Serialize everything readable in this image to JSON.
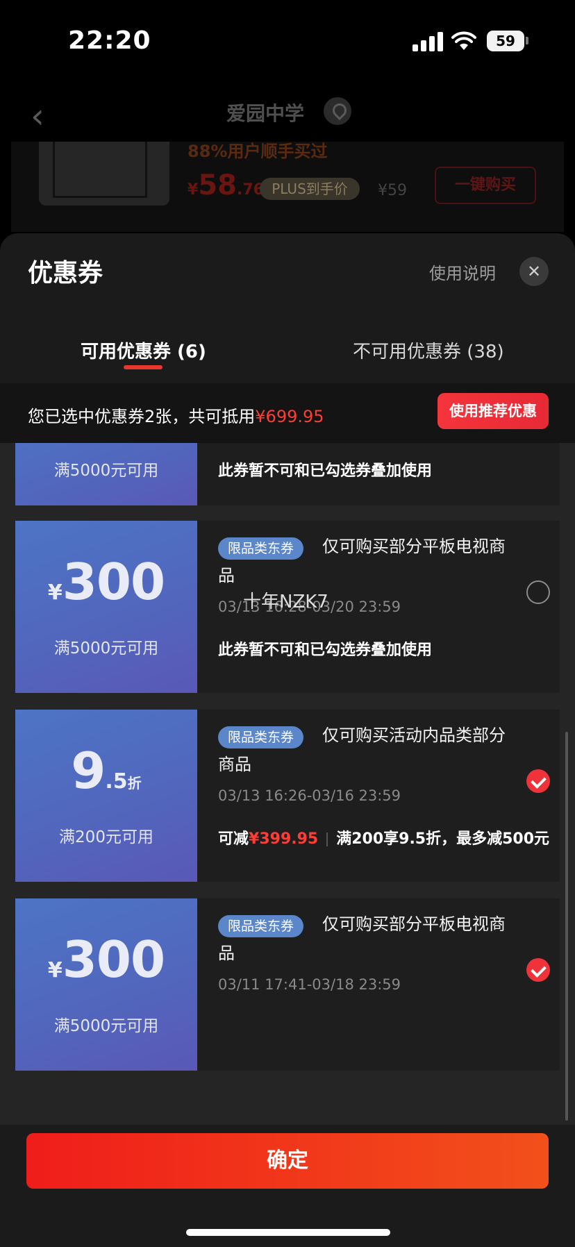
{
  "status_bar": {
    "time": "22:20",
    "battery": "59"
  },
  "background_page": {
    "title": "爱园中学",
    "slogan": "88%用户顺手买过",
    "price_currency": "¥",
    "price_int": "58",
    "price_dec": ".76",
    "plus_label": "PLUS到手价",
    "original_price": "¥59",
    "buy_button": "一键购买"
  },
  "sheet": {
    "title": "优惠券",
    "help": "使用说明",
    "close_icon": "close-icon",
    "tabs": [
      {
        "label": "可用优惠券 (6)",
        "active": true
      },
      {
        "label": "不可用优惠券 (38)",
        "active": false
      }
    ],
    "summary_prefix": "您已选中优惠券2张，共可抵用",
    "summary_amount": "¥699.95",
    "recommend_button": "使用推荐优惠"
  },
  "coupons": [
    {
      "condition": "满5000元可用",
      "note": "此券暂不可和已勾选券叠加使用"
    },
    {
      "currency": "¥",
      "amount": "300",
      "condition": "满5000元可用",
      "tag": "限品类东券",
      "description": "仅可购买部分平板电视商品",
      "date": "03/13 16:28-03/20 23:59",
      "note": "此券暂不可和已勾选券叠加使用",
      "checked": false
    },
    {
      "amount": "9",
      "decimal": ".5",
      "unit": "折",
      "condition": "满200元可用",
      "tag": "限品类东券",
      "description": "仅可购买活动内品类部分商品",
      "date": "03/13 16:26-03/16 23:59",
      "save_prefix": "可减",
      "save_amount": "¥399.95",
      "rule": "满200享9.5折，最多减500元",
      "checked": true
    },
    {
      "currency": "¥",
      "amount": "300",
      "condition": "满5000元可用",
      "tag": "限品类东券",
      "description": "仅可购买部分平板电视商品",
      "date": "03/11 17:41-03/18 23:59",
      "checked": true
    }
  ],
  "watermark": "十年NZK7",
  "confirm_button": "确定"
}
